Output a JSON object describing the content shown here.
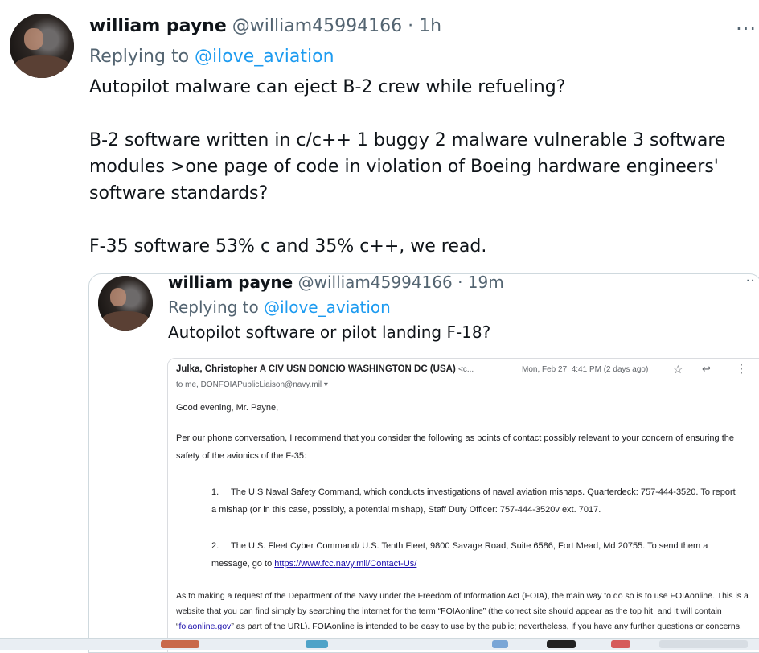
{
  "tweet": {
    "author_name": "william payne",
    "handle": "@william45994166",
    "separator": "·",
    "time": "1h",
    "more_label": "···",
    "replying_prefix": "Replying to ",
    "replying_to": "@ilove_aviation",
    "paragraphs": [
      "Autopilot malware can eject B-2 crew while refueling?",
      "B-2 software written in c/c++ 1 buggy 2 malware vulnerable 3 software modules >one page of code in violation of Boeing hardware engineers' software standards?",
      "F-35 software 53% c and 35% c++, we read."
    ]
  },
  "quoted": {
    "author_name": "william payne",
    "handle": "@william45994166",
    "separator": "·",
    "time": "19m",
    "more_label": "··",
    "replying_prefix": "Replying to ",
    "replying_to": "@ilove_aviation",
    "text": "Autopilot software or pilot landing F-18?",
    "email": {
      "from": "Julka, Christopher A CIV USN DONCIO WASHINGTON DC (USA)",
      "from_fragment": "<c...",
      "date": "Mon, Feb 27, 4:41 PM (2 days ago)",
      "star_icon": "☆",
      "reply_icon": "↩",
      "kebab_icon": "⋮",
      "to": "to me, DONFOIAPublicLiaison@navy.mil ▾",
      "greeting": "Good evening, Mr. Payne,",
      "intro": "Per our phone conversation, I recommend that you consider the following as points of contact possibly relevant to your concern of ensuring the safety of the avionics of the F-35:",
      "items": [
        {
          "num": "1.",
          "text": "The U.S Naval Safety Command, which conducts investigations of naval aviation mishaps.  Quarterdeck: 757-444-3520.  To report a mishap (or in this case, possibly, a potential mishap), Staff Duty Officer: 757-444-3520v ext. 7017."
        },
        {
          "num": "2.",
          "text_before": "The U.S. Fleet Cyber Command/ U.S. Tenth Fleet, 9800 Savage Road, Suite 6586, Fort Mead, Md 20755.  To send them a message, go to ",
          "link": "https://www.fcc.navy.mil/Contact-Us/"
        }
      ],
      "closing_before": "As to making a request of the Department of the Navy under the Freedom of Information Act (FOIA), the main way to do so is to use FOIAonline.  This is a website that you can find simply by searching the internet for the term “FOIAonline” (the correct site should appear as the top hit, and it will contain “",
      "closing_link": "foiaonline.gov",
      "closing_after": "” as part of the URL).  FOIAonline is intended to be easy to use by the public; nevertheless, if you have any further questions or concerns, do not hesitate to let me know."
    }
  },
  "colors": {
    "text": "#0f1419",
    "secondary": "#536471",
    "link": "#1d9bf0",
    "border": "#cfd9de"
  }
}
